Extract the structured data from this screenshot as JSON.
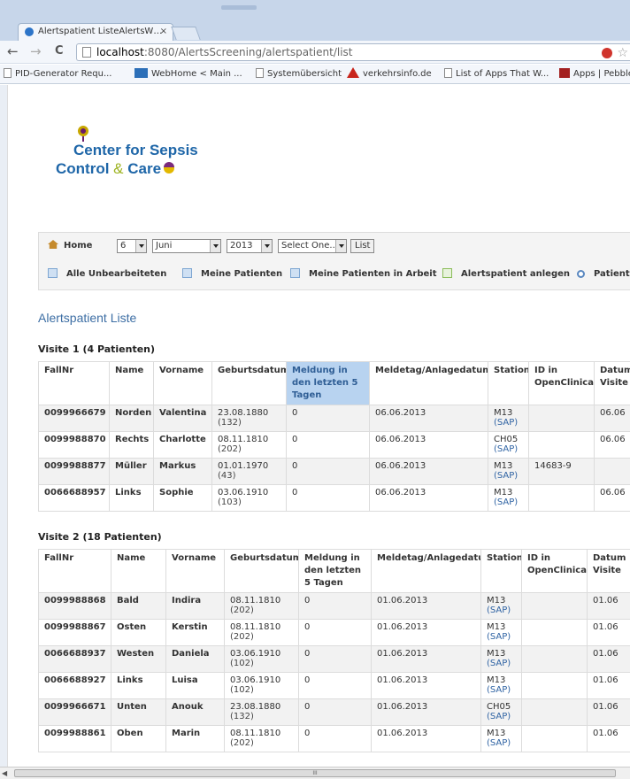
{
  "browser": {
    "tab_title": "Alertspatient ListeAlertsW…",
    "tab_close": "×",
    "url_host": "localhost",
    "url_rest": ":8080/AlertsScreening/alertspatient/list",
    "back": "←",
    "forward": "→",
    "reload": "C",
    "star": "☆",
    "bookmarks": [
      {
        "label": "PID-Generator Requ...",
        "icon": "page-icon"
      },
      {
        "label": "WebHome < Main ...",
        "icon": "fw-icon"
      },
      {
        "label": "Systemübersicht",
        "icon": "page-icon"
      },
      {
        "label": "verkehrsinfo.de",
        "icon": "warning-icon"
      },
      {
        "label": "List of Apps That W...",
        "icon": "page-icon"
      },
      {
        "label": "Apps | Pebble",
        "icon": "pebble-icon"
      }
    ]
  },
  "logo": {
    "line1": "Center for Sepsis",
    "line2a": "Control ",
    "amp": "&",
    "line2b": " Care"
  },
  "nav": {
    "home": "Home",
    "day": "6",
    "month": "Juni",
    "year": "2013",
    "select": "Select One...",
    "list_button": "List",
    "links": [
      "Alle Unbearbeiteten",
      "Meine Patienten",
      "Meine Patienten in Arbeit",
      "Alertspatient anlegen",
      "Patient su"
    ]
  },
  "page_title": "Alertspatient Liste",
  "columns": [
    "FallNr",
    "Name",
    "Vorname",
    "Geburtsdatum",
    "Meldung in den letzten 5 Tagen",
    "Meldetag/Anlagedatum",
    "Station",
    "ID in OpenClinica",
    "Datum Visite"
  ],
  "visit1": {
    "title": "Visite 1 (4 Patienten)",
    "rows": [
      {
        "fallnr": "0099966679",
        "name": "Norden",
        "vorname": "Valentina",
        "geb": "23.08.1880",
        "alter": "(132)",
        "meldung": "0",
        "meldetag": "06.06.2013",
        "station": "M13",
        "sap": "(SAP)",
        "oc": "",
        "datum": "06.06"
      },
      {
        "fallnr": "0099988870",
        "name": "Rechts",
        "vorname": "Charlotte",
        "geb": "08.11.1810",
        "alter": "(202)",
        "meldung": "0",
        "meldetag": "06.06.2013",
        "station": "CH05",
        "sap": "(SAP)",
        "oc": "",
        "datum": "06.06"
      },
      {
        "fallnr": "0099988877",
        "name": "Müller",
        "vorname": "Markus",
        "geb": "01.01.1970",
        "alter": "(43)",
        "meldung": "0",
        "meldetag": "06.06.2013",
        "station": "M13",
        "sap": "(SAP)",
        "oc": "14683-9",
        "datum": ""
      },
      {
        "fallnr": "0066688957",
        "name": "Links",
        "vorname": "Sophie",
        "geb": "03.06.1910",
        "alter": "(103)",
        "meldung": "0",
        "meldetag": "06.06.2013",
        "station": "M13",
        "sap": "(SAP)",
        "oc": "",
        "datum": "06.06"
      }
    ]
  },
  "visit2": {
    "title": "Visite 2 (18 Patienten)",
    "rows": [
      {
        "fallnr": "0099988868",
        "name": "Bald",
        "vorname": "Indira",
        "geb": "08.11.1810",
        "alter": "(202)",
        "meldung": "0",
        "meldetag": "01.06.2013",
        "station": "M13",
        "sap": "(SAP)",
        "oc": "",
        "datum": "01.06"
      },
      {
        "fallnr": "0099988867",
        "name": "Osten",
        "vorname": "Kerstin",
        "geb": "08.11.1810",
        "alter": "(202)",
        "meldung": "0",
        "meldetag": "01.06.2013",
        "station": "M13",
        "sap": "(SAP)",
        "oc": "",
        "datum": "01.06"
      },
      {
        "fallnr": "0066688937",
        "name": "Westen",
        "vorname": "Daniela",
        "geb": "03.06.1910",
        "alter": "(102)",
        "meldung": "0",
        "meldetag": "01.06.2013",
        "station": "M13",
        "sap": "(SAP)",
        "oc": "",
        "datum": "01.06"
      },
      {
        "fallnr": "0066688927",
        "name": "Links",
        "vorname": "Luisa",
        "geb": "03.06.1910",
        "alter": "(102)",
        "meldung": "0",
        "meldetag": "01.06.2013",
        "station": "M13",
        "sap": "(SAP)",
        "oc": "",
        "datum": "01.06"
      },
      {
        "fallnr": "0099966671",
        "name": "Unten",
        "vorname": "Anouk",
        "geb": "23.08.1880",
        "alter": "(132)",
        "meldung": "0",
        "meldetag": "01.06.2013",
        "station": "CH05",
        "sap": "(SAP)",
        "oc": "",
        "datum": "01.06"
      },
      {
        "fallnr": "0099988861",
        "name": "Oben",
        "vorname": "Marin",
        "geb": "08.11.1810",
        "alter": "(202)",
        "meldung": "0",
        "meldetag": "01.06.2013",
        "station": "M13",
        "sap": "(SAP)",
        "oc": "",
        "datum": "01.06"
      }
    ]
  },
  "scroll_grip": "III"
}
